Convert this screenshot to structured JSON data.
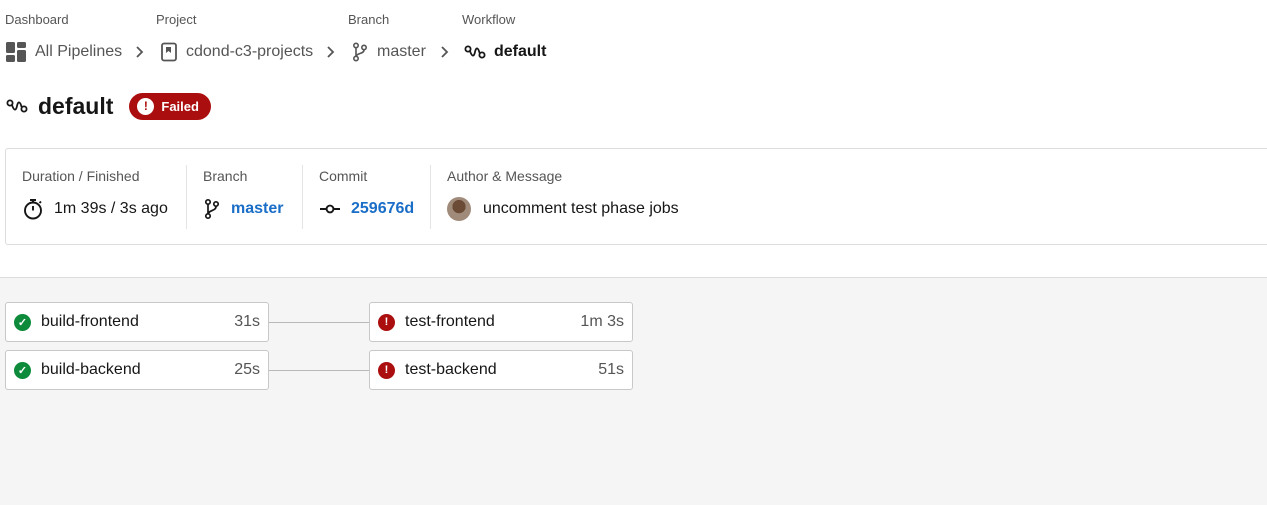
{
  "breadcrumb": {
    "labels": {
      "dashboard": "Dashboard",
      "project": "Project",
      "branch": "Branch",
      "workflow": "Workflow"
    },
    "items": {
      "dashboard": "All Pipelines",
      "project": "cdond-c3-projects",
      "branch": "master",
      "workflow": "default"
    }
  },
  "header": {
    "title": "default",
    "status": "Failed",
    "status_color": "#ab0e0e"
  },
  "info": {
    "duration": {
      "label": "Duration / Finished",
      "value": "1m 39s / 3s ago"
    },
    "branch": {
      "label": "Branch",
      "value": "master"
    },
    "commit": {
      "label": "Commit",
      "value": "259676d"
    },
    "author": {
      "label": "Author & Message",
      "message": "uncomment test phase jobs"
    }
  },
  "pipeline": {
    "jobs": [
      {
        "name": "build-frontend",
        "time": "31s",
        "status": "success"
      },
      {
        "name": "build-backend",
        "time": "25s",
        "status": "success"
      },
      {
        "name": "test-frontend",
        "time": "1m 3s",
        "status": "failed"
      },
      {
        "name": "test-backend",
        "time": "51s",
        "status": "failed"
      }
    ]
  },
  "colors": {
    "success": "#0d8a3a",
    "failed": "#ab0e0e",
    "link": "#1a6ec7"
  },
  "icons": [
    "dashboard-icon",
    "project-icon",
    "branch-icon",
    "workflow-icon",
    "chevron-right-icon",
    "timer-icon",
    "commit-icon",
    "check-circle-icon",
    "alert-circle-icon"
  ]
}
